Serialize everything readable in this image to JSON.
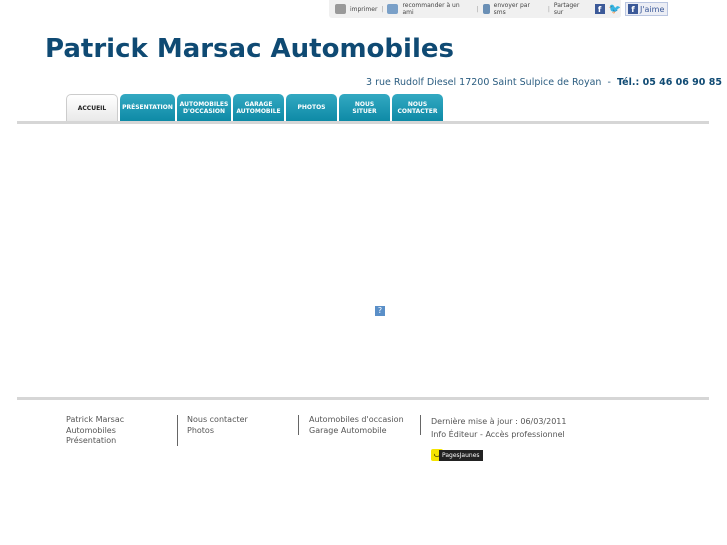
{
  "topbar": {
    "print": "imprimer",
    "recommend": "recommander à un ami",
    "sms": "envoyer par sms",
    "share": "Partager sur",
    "like": "J'aime"
  },
  "header": {
    "title": "Patrick Marsac Automobiles",
    "address": "3 rue Rudolf Diesel 17200 Saint Sulpice de Royan",
    "phone": "Tél.: 05 46 06 90 85"
  },
  "nav": [
    {
      "l1": "ACCUEIL",
      "l2": ""
    },
    {
      "l1": "PRÉSENTATION",
      "l2": ""
    },
    {
      "l1": "AUTOMOBILES",
      "l2": "D'OCCASION"
    },
    {
      "l1": "GARAGE",
      "l2": "AUTOMOBILE"
    },
    {
      "l1": "PHOTOS",
      "l2": ""
    },
    {
      "l1": "NOUS",
      "l2": "SITUER"
    },
    {
      "l1": "NOUS",
      "l2": "CONTACTER"
    }
  ],
  "footer": {
    "col1": [
      "Patrick Marsac",
      "Automobiles",
      "Présentation"
    ],
    "col2": [
      "Nous contacter",
      "Photos"
    ],
    "col3": [
      "Automobiles d'occasion",
      "Garage Automobile"
    ],
    "updated": "Dernière mise à jour : 06/03/2011",
    "info": "Info Éditeur",
    "dash": "-",
    "pro": "Accès professionnel",
    "pj": "PagesJaunes"
  }
}
